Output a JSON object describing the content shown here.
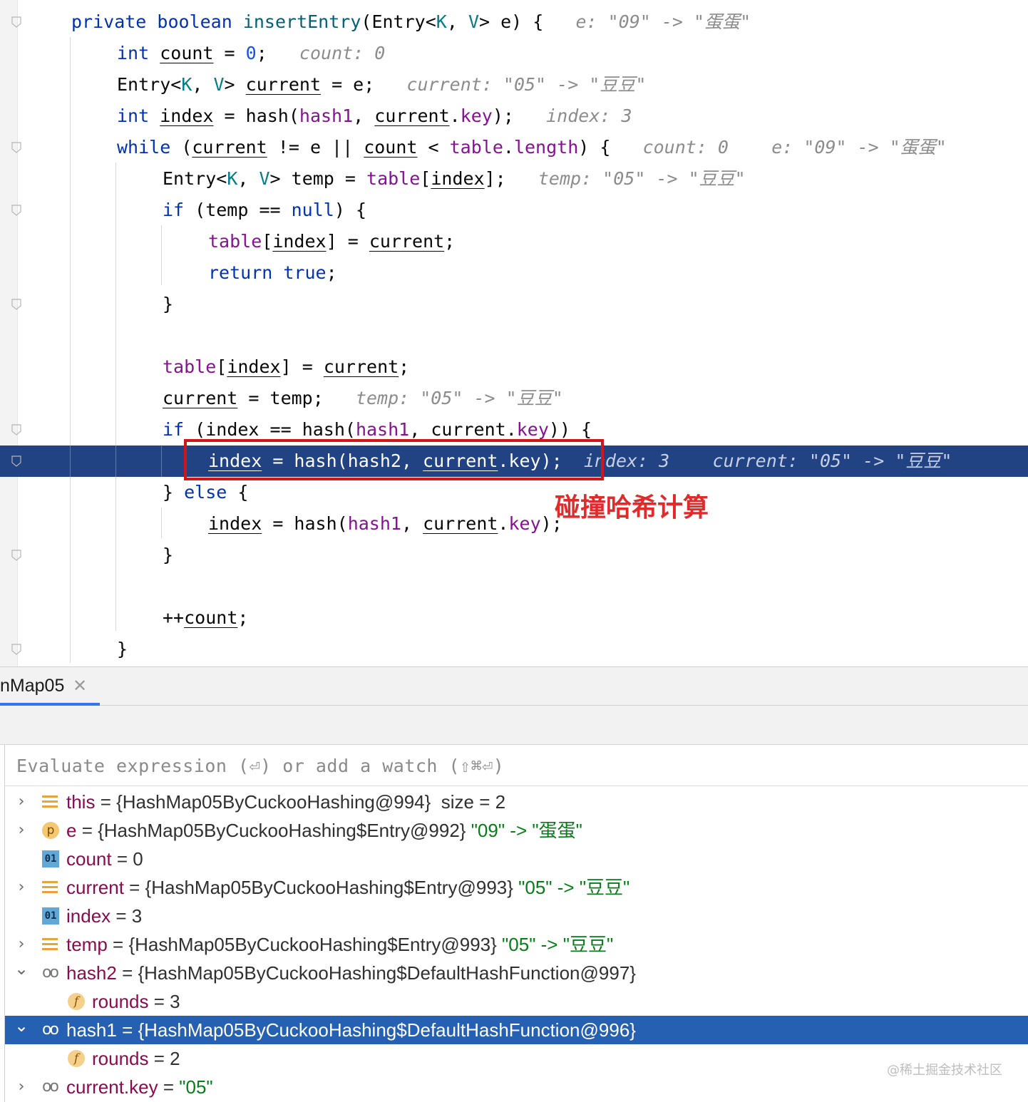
{
  "editor": {
    "lines": [
      {
        "indent": 4,
        "tokens": [
          {
            "t": "private boolean ",
            "c": "k"
          },
          {
            "t": "insertEntry",
            "c": "f"
          },
          {
            "t": "(Entry<"
          },
          {
            "t": "K",
            "c": "tp"
          },
          {
            "t": ", "
          },
          {
            "t": "V",
            "c": "tp"
          },
          {
            "t": "> e) {   "
          },
          {
            "t": "e: \"09\" -> \"蛋蛋\"",
            "c": "hint"
          }
        ]
      },
      {
        "indent": 8,
        "tokens": [
          {
            "t": "int ",
            "c": "k"
          },
          {
            "t": "count",
            "c": "u"
          },
          {
            "t": " = "
          },
          {
            "t": "0",
            "c": "nm"
          },
          {
            "t": ";   "
          },
          {
            "t": "count: 0",
            "c": "hint"
          }
        ]
      },
      {
        "indent": 8,
        "tokens": [
          {
            "t": "Entry<"
          },
          {
            "t": "K",
            "c": "tp"
          },
          {
            "t": ", "
          },
          {
            "t": "V",
            "c": "tp"
          },
          {
            "t": "> "
          },
          {
            "t": "current",
            "c": "u"
          },
          {
            "t": " = e;   "
          },
          {
            "t": "current: \"05\" -> \"豆豆\"",
            "c": "hint"
          }
        ]
      },
      {
        "indent": 8,
        "tokens": [
          {
            "t": "int ",
            "c": "k"
          },
          {
            "t": "index",
            "c": "u"
          },
          {
            "t": " = hash("
          },
          {
            "t": "hash1",
            "c": "fl"
          },
          {
            "t": ", "
          },
          {
            "t": "current",
            "c": "u"
          },
          {
            "t": "."
          },
          {
            "t": "key",
            "c": "fl"
          },
          {
            "t": ");   "
          },
          {
            "t": "index: 3",
            "c": "hint"
          }
        ]
      },
      {
        "indent": 8,
        "tokens": [
          {
            "t": "while ",
            "c": "k"
          },
          {
            "t": "("
          },
          {
            "t": "current",
            "c": "u"
          },
          {
            "t": " != e || "
          },
          {
            "t": "count",
            "c": "u"
          },
          {
            "t": " < "
          },
          {
            "t": "table",
            "c": "fl"
          },
          {
            "t": "."
          },
          {
            "t": "length",
            "c": "fl"
          },
          {
            "t": ") {   "
          },
          {
            "t": "count: 0    e: \"09\" -> \"蛋蛋\"",
            "c": "hint"
          }
        ]
      },
      {
        "indent": 12,
        "tokens": [
          {
            "t": "Entry<"
          },
          {
            "t": "K",
            "c": "tp"
          },
          {
            "t": ", "
          },
          {
            "t": "V",
            "c": "tp"
          },
          {
            "t": "> temp = "
          },
          {
            "t": "table",
            "c": "fl"
          },
          {
            "t": "["
          },
          {
            "t": "index",
            "c": "u"
          },
          {
            "t": "];   "
          },
          {
            "t": "temp: \"05\" -> \"豆豆\"",
            "c": "hint"
          }
        ]
      },
      {
        "indent": 12,
        "tokens": [
          {
            "t": "if ",
            "c": "k"
          },
          {
            "t": "(temp == "
          },
          {
            "t": "null",
            "c": "k"
          },
          {
            "t": ") {"
          }
        ]
      },
      {
        "indent": 16,
        "tokens": [
          {
            "t": "table",
            "c": "fl"
          },
          {
            "t": "["
          },
          {
            "t": "index",
            "c": "u"
          },
          {
            "t": "] = "
          },
          {
            "t": "current",
            "c": "u"
          },
          {
            "t": ";"
          }
        ]
      },
      {
        "indent": 16,
        "tokens": [
          {
            "t": "return true",
            "c": "k"
          },
          {
            "t": ";"
          }
        ]
      },
      {
        "indent": 12,
        "tokens": [
          {
            "t": "}"
          }
        ]
      },
      {
        "indent": 0,
        "tokens": []
      },
      {
        "indent": 12,
        "tokens": [
          {
            "t": "table",
            "c": "fl"
          },
          {
            "t": "["
          },
          {
            "t": "index",
            "c": "u"
          },
          {
            "t": "] = "
          },
          {
            "t": "current",
            "c": "u"
          },
          {
            "t": ";"
          }
        ]
      },
      {
        "indent": 12,
        "tokens": [
          {
            "t": "current",
            "c": "u"
          },
          {
            "t": " = temp;   "
          },
          {
            "t": "temp: \"05\" -> \"豆豆\"",
            "c": "hint"
          }
        ]
      },
      {
        "indent": 12,
        "tokens": [
          {
            "t": "if ",
            "c": "k"
          },
          {
            "t": "("
          },
          {
            "t": "index",
            "c": "u"
          },
          {
            "t": " == hash("
          },
          {
            "t": "hash1",
            "c": "fl"
          },
          {
            "t": ", "
          },
          {
            "t": "current",
            "c": "u"
          },
          {
            "t": "."
          },
          {
            "t": "key",
            "c": "fl"
          },
          {
            "t": ")) {"
          }
        ]
      },
      {
        "indent": 16,
        "current": true,
        "tokens": [
          {
            "t": "index",
            "c": "u"
          },
          {
            "t": " = hash(hash2, "
          },
          {
            "t": "current",
            "c": "u"
          },
          {
            "t": ".key);  "
          },
          {
            "t": "index: 3    current: \"05\" -> \"豆豆\"",
            "c": "hint"
          }
        ]
      },
      {
        "indent": 12,
        "tokens": [
          {
            "t": "} "
          },
          {
            "t": "else",
            "c": "k"
          },
          {
            "t": " {"
          }
        ]
      },
      {
        "indent": 16,
        "tokens": [
          {
            "t": "index",
            "c": "u"
          },
          {
            "t": " = hash("
          },
          {
            "t": "hash1",
            "c": "fl"
          },
          {
            "t": ", "
          },
          {
            "t": "current",
            "c": "u"
          },
          {
            "t": "."
          },
          {
            "t": "key",
            "c": "fl"
          },
          {
            "t": ");"
          }
        ]
      },
      {
        "indent": 12,
        "tokens": [
          {
            "t": "}"
          }
        ]
      },
      {
        "indent": 0,
        "tokens": []
      },
      {
        "indent": 12,
        "tokens": [
          {
            "t": "++"
          },
          {
            "t": "count",
            "c": "u"
          },
          {
            "t": ";"
          }
        ]
      },
      {
        "indent": 8,
        "tokens": [
          {
            "t": "}"
          }
        ]
      }
    ],
    "annotation": "碰撞哈希计算"
  },
  "debug": {
    "tab_label": "nMap05",
    "tab_close": "✕",
    "watch_placeholder": "Evaluate expression (⏎) or add a watch (⇧⌘⏎)",
    "variables": [
      {
        "arrow": "›",
        "icon": "list",
        "indent": 0,
        "name": "this",
        "val": " = {HashMap05ByCuckooHashing@994}  size = 2",
        "str": ""
      },
      {
        "arrow": "›",
        "icon": "p",
        "indent": 0,
        "name": "e",
        "val": " = {HashMap05ByCuckooHashing$Entry@992} ",
        "str": "\"09\" -> \"蛋蛋\""
      },
      {
        "arrow": "",
        "icon": "01",
        "indent": 0,
        "name": "count",
        "val": " = 0",
        "str": ""
      },
      {
        "arrow": "›",
        "icon": "list",
        "indent": 0,
        "name": "current",
        "val": " = {HashMap05ByCuckooHashing$Entry@993} ",
        "str": "\"05\" -> \"豆豆\""
      },
      {
        "arrow": "",
        "icon": "01",
        "indent": 0,
        "name": "index",
        "val": " = 3",
        "str": ""
      },
      {
        "arrow": "›",
        "icon": "list",
        "indent": 0,
        "name": "temp",
        "val": " = {HashMap05ByCuckooHashing$Entry@993} ",
        "str": "\"05\" -> \"豆豆\""
      },
      {
        "arrow": "⌄",
        "icon": "oo",
        "indent": 0,
        "name": "hash2",
        "val": " = {HashMap05ByCuckooHashing$DefaultHashFunction@997}",
        "str": ""
      },
      {
        "arrow": "",
        "icon": "f",
        "indent": 1,
        "name": "rounds",
        "val": " = 3",
        "str": ""
      },
      {
        "arrow": "⌄",
        "icon": "oo",
        "indent": 0,
        "name": "hash1",
        "val": " = {HashMap05ByCuckooHashing$DefaultHashFunction@996}",
        "str": "",
        "selected": true
      },
      {
        "arrow": "",
        "icon": "f",
        "indent": 1,
        "name": "rounds",
        "val": " = 2",
        "str": ""
      },
      {
        "arrow": "›",
        "icon": "oo",
        "indent": 0,
        "name": "current.key",
        "val": " = ",
        "str": "\"05\""
      }
    ],
    "icon_glyphs": {
      "p": "p",
      "f": "f",
      "01": "01",
      "oo": "oo"
    }
  },
  "watermark": "@稀土掘金技术社区"
}
